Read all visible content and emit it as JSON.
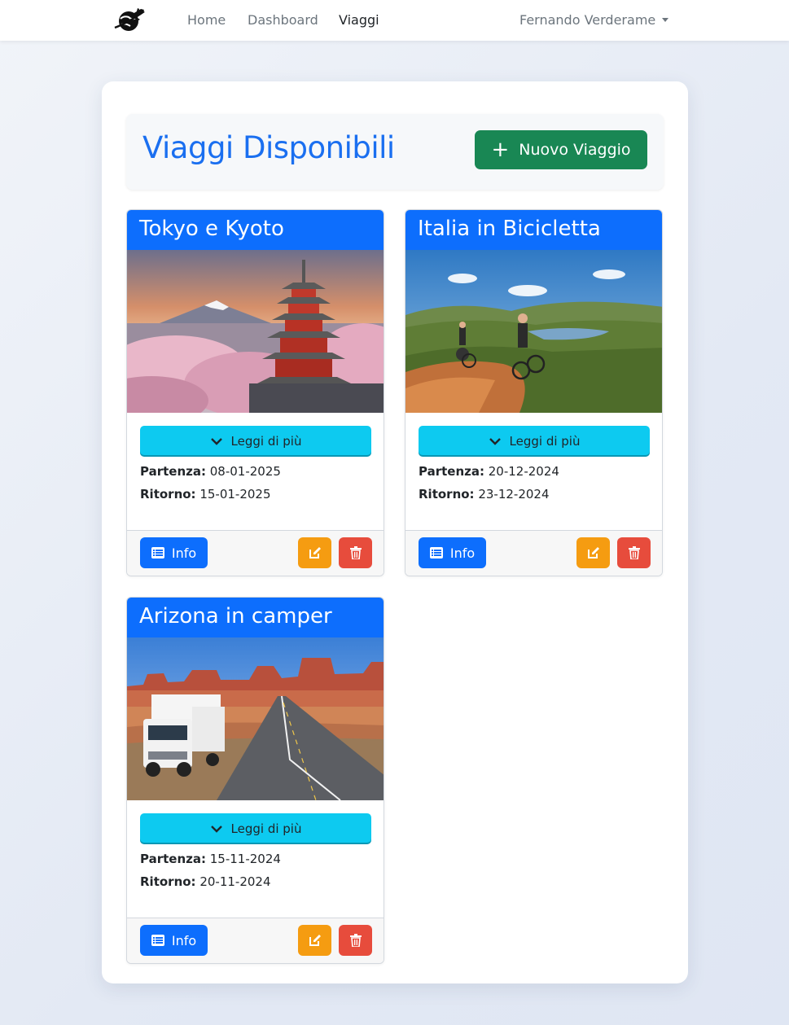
{
  "navbar": {
    "logo": "plane-globe-logo",
    "links": [
      {
        "label": "Home",
        "active": false
      },
      {
        "label": "Dashboard",
        "active": false
      },
      {
        "label": "Viaggi",
        "active": true
      }
    ],
    "user": "Fernando Verderame"
  },
  "page": {
    "title": "Viaggi Disponibili",
    "new_trip_button": "Nuovo Viaggio"
  },
  "trips": [
    {
      "title": "Tokyo e Kyoto",
      "image": "pagoda-mount-fuji-cherry-blossom",
      "read_more": "Leggi di più",
      "departure_label": "Partenza:",
      "departure": "08-01-2025",
      "return_label": "Ritorno:",
      "return": "15-01-2025",
      "info_label": "Info"
    },
    {
      "title": "Italia in Bicicletta",
      "image": "cyclists-hill-trail-lake",
      "read_more": "Leggi di più",
      "departure_label": "Partenza:",
      "departure": "20-12-2024",
      "return_label": "Ritorno:",
      "return": "23-12-2024",
      "info_label": "Info"
    },
    {
      "title": "Arizona in camper",
      "image": "camper-desert-road-monument-valley",
      "read_more": "Leggi di più",
      "departure_label": "Partenza:",
      "departure": "15-11-2024",
      "return_label": "Ritorno:",
      "return": "20-11-2024",
      "info_label": "Info"
    }
  ],
  "colors": {
    "primary": "#0d6efd",
    "title": "#1a6ff0",
    "success": "#198754",
    "info": "#0dcaf0",
    "warning": "#f59c11",
    "danger": "#e74c3c"
  }
}
